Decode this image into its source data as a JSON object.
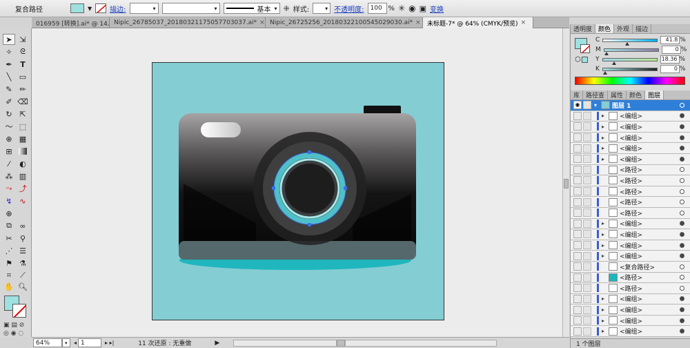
{
  "control_bar": {
    "selection_label": "复合路径",
    "stroke_label": "描边:",
    "brush_label": "基本",
    "style_label": "样式:",
    "opacity_label": "不透明度:",
    "opacity_value": "100",
    "percent": "%",
    "transform_label": "变换"
  },
  "tabs": [
    {
      "label": "016959 [转换].ai* @ 14..."
    },
    {
      "label": "Nipic_26785037_20180321175057703037.ai*"
    },
    {
      "label": "Nipic_26725256_20180322100545029030.ai*"
    },
    {
      "label": "未标题-7* @ 64% (CMYK/预览)",
      "active": true
    }
  ],
  "tab_close": "×",
  "colors": {
    "accent": "#2f7fd8",
    "fill": "#9fe0e0",
    "artboard": "#84cdd3",
    "lens_ring": "#4fc0c7",
    "shadow": "#1fb7bd"
  },
  "color_panel": {
    "tabs": [
      "透明度",
      "颜色",
      "外观",
      "描边"
    ],
    "active": "颜色",
    "channels": [
      {
        "label": "C",
        "value": "41.8",
        "fraction": 0.418
      },
      {
        "label": "M",
        "value": "0",
        "fraction": 0
      },
      {
        "label": "Y",
        "value": "18.36",
        "fraction": 0.1836
      },
      {
        "label": "K",
        "value": "0",
        "fraction": 0
      }
    ],
    "percent": "%"
  },
  "layers_panel": {
    "tabs": [
      "库",
      "路径查",
      "属性",
      "颜色",
      "图层"
    ],
    "active": "图层",
    "layer_name": "图层 1",
    "rows": [
      {
        "label": "<编组>",
        "group": true
      },
      {
        "label": "<编组>",
        "group": true
      },
      {
        "label": "<编组>",
        "group": true
      },
      {
        "label": "<编组>",
        "group": true
      },
      {
        "label": "<编组>",
        "group": true
      },
      {
        "label": "<路径>",
        "group": false
      },
      {
        "label": "<路径>",
        "group": false
      },
      {
        "label": "<路径>",
        "group": false
      },
      {
        "label": "<路径>",
        "group": false
      },
      {
        "label": "<路径>",
        "group": false
      },
      {
        "label": "<编组>",
        "group": true
      },
      {
        "label": "<编组>",
        "group": true
      },
      {
        "label": "<编组>",
        "group": true
      },
      {
        "label": "<编组>",
        "group": true
      },
      {
        "label": "<复合路径>",
        "group": false
      },
      {
        "label": "<路径>",
        "group": false
      },
      {
        "label": "<路径>",
        "group": false
      },
      {
        "label": "<编组>",
        "group": true
      },
      {
        "label": "<编组>",
        "group": true
      },
      {
        "label": "<编组>",
        "group": true
      },
      {
        "label": "<编组>",
        "group": true
      }
    ],
    "footer": "1 个图层"
  },
  "status": {
    "zoom": "64%",
    "artboard": "1",
    "undo": "11 次还原 : 无重做"
  }
}
